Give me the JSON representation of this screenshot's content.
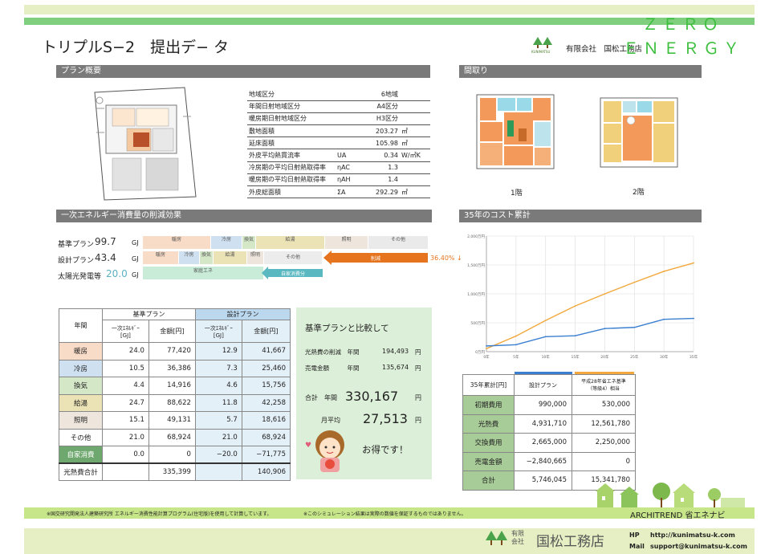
{
  "header": {
    "title": "トリプルS−2　提出デ− タ",
    "company_small_logo_text": "KUNIMATSU",
    "company": "有限会社　国松工務店",
    "brand_line1": "ＺＥＲＯ",
    "brand_line2": "ＥＮＥＲＧＹ"
  },
  "sections": {
    "plan_overview": "プラン概要",
    "floor_plan": "間取り",
    "energy_reduction": "一次エネルギー消費量の削減効果",
    "cost_35": "35年のコスト累計"
  },
  "spec_rows": [
    {
      "label": "地域区分",
      "sym": "",
      "value": "6地域",
      "unit": ""
    },
    {
      "label": "年間日射地域区分",
      "sym": "",
      "value": "A4区分",
      "unit": ""
    },
    {
      "label": "暖房期日射地域区分",
      "sym": "",
      "value": "H3区分",
      "unit": ""
    },
    {
      "label": "敷地面積",
      "sym": "",
      "value": "203.27",
      "unit": "㎡"
    },
    {
      "label": "延床面積",
      "sym": "",
      "value": "105.98",
      "unit": "㎡"
    },
    {
      "label": "外皮平均熱貫流率",
      "sym": "UA",
      "value": "0.34",
      "unit": "W/㎡K"
    },
    {
      "label": "冷房期の平均日射熱取得率",
      "sym": "ηAC",
      "value": "1.3",
      "unit": ""
    },
    {
      "label": "暖房期の平均日射熱取得率",
      "sym": "ηAH",
      "value": "1.4",
      "unit": ""
    },
    {
      "label": "外皮総面積",
      "sym": "ΣA",
      "value": "292.29",
      "unit": "㎡"
    }
  ],
  "floors": {
    "first": "1階",
    "second": "2階"
  },
  "energy_bars": {
    "base": {
      "label": "基準プラン",
      "value": "99.7",
      "unit": "GJ"
    },
    "design": {
      "label": "設計プラン",
      "value": "43.4",
      "unit": "GJ"
    },
    "solar": {
      "label": "太陽光発電等",
      "value": "20.0",
      "unit": "GJ"
    },
    "seg_heating": "暖房",
    "seg_cooling": "冷房",
    "seg_vent": "換気",
    "seg_hotwater": "給湯",
    "seg_light": "照明",
    "seg_other": "その他",
    "seg_reduce": "削減",
    "reduce_pct": "36.40% ↓",
    "seg_selfgen": "家庭エネ",
    "seg_selfuse": "自家消費分"
  },
  "table": {
    "h_year": "年間",
    "h_base": "基準プラン",
    "h_design": "設計プラン",
    "h_energy": "一次ｴﾈﾙｷﾞｰ\n[GJ]",
    "h_yen": "金額[円]",
    "rows": [
      {
        "name": "暖房",
        "color": "#f8dcc8",
        "b_gj": "24.0",
        "b_yen": "77,420",
        "d_gj": "12.9",
        "d_yen": "41,667"
      },
      {
        "name": "冷房",
        "color": "#cfe0f0",
        "b_gj": "10.5",
        "b_yen": "36,386",
        "d_gj": "7.3",
        "d_yen": "25,460"
      },
      {
        "name": "換気",
        "color": "#d4e8c8",
        "b_gj": "4.4",
        "b_yen": "14,916",
        "d_gj": "4.6",
        "d_yen": "15,756"
      },
      {
        "name": "給湯",
        "color": "#ebe2b6",
        "b_gj": "24.7",
        "b_yen": "88,622",
        "d_gj": "11.8",
        "d_yen": "42,258"
      },
      {
        "name": "照明",
        "color": "#eee6dc",
        "b_gj": "15.1",
        "b_yen": "49,131",
        "d_gj": "5.7",
        "d_yen": "18,616"
      },
      {
        "name": "その他",
        "color": "#ffffff",
        "b_gj": "21.0",
        "b_yen": "68,924",
        "d_gj": "21.0",
        "d_yen": "68,924"
      },
      {
        "name": "自家消費",
        "color": "#6fa86f",
        "b_gj": "0.0",
        "b_yen": "0",
        "d_gj": "−20.0",
        "d_yen": "−71,775"
      }
    ],
    "total_label": "光熱費合計",
    "total_base": "335,399",
    "total_design": "140,906"
  },
  "compare": {
    "title": "基準プランと比較して",
    "line1_label": "光熱費の削減　年間",
    "line1_value": "194,493",
    "line2_label": "売電金額　　　年間",
    "line2_value": "135,674",
    "yen": "円",
    "sum_label": "合計　年間",
    "sum_value": "330,167",
    "month_label": "月平均",
    "month_value": "27,513",
    "otoku": "お得です！"
  },
  "chart_data": {
    "type": "line",
    "x": [
      0,
      5,
      10,
      15,
      20,
      25,
      30,
      35
    ],
    "xticks": [
      "0年",
      "5年",
      "10年",
      "15年",
      "20年",
      "25年",
      "30年",
      "35年"
    ],
    "ylabel_ticks": [
      "0万円",
      "500万円",
      "1,000万円",
      "1,500万円",
      "2,000万円"
    ],
    "ylim": [
      0,
      2000
    ],
    "series": [
      {
        "name": "",
        "color": "#f2a83c",
        "values": [
          53,
          270,
          540,
          790,
          1000,
          1200,
          1390,
          1534
        ]
      },
      {
        "name": "",
        "color": "#3a7fd0",
        "values": [
          99,
          120,
          260,
          275,
          400,
          420,
          560,
          575
        ]
      }
    ]
  },
  "cost_table": {
    "h_label": "35年累計[円]",
    "h_design": "設計プラン",
    "h_base": "平成28年省エネ基準\n（等級4）相当",
    "rows": [
      {
        "name": "初期費用",
        "design": "990,000",
        "base": "530,000"
      },
      {
        "name": "光熱費",
        "design": "4,931,710",
        "base": "12,561,780"
      },
      {
        "name": "交換費用",
        "design": "2,665,000",
        "base": "2,250,000"
      },
      {
        "name": "売電金額",
        "design": "−2,840,665",
        "base": "0"
      },
      {
        "name": "合計",
        "design": "5,746,045",
        "base": "15,341,780"
      }
    ]
  },
  "footer": {
    "note1": "※国交研究開発法人建築研究所 エネルギー消費性能計算プログラム(住宅版)を使用して計算しています。",
    "note2": "※このシミュレーション結果は実際の数値を保証するものではありません。",
    "archi": "ARCHITREND 省エネナビ",
    "company_prefix": "有限\n会社",
    "company": "国松工務店",
    "hp_label": "HP",
    "hp": "http://kunimatsu-k.com",
    "mail_label": "Mail",
    "mail": "support@kunimatsu-k.com"
  }
}
